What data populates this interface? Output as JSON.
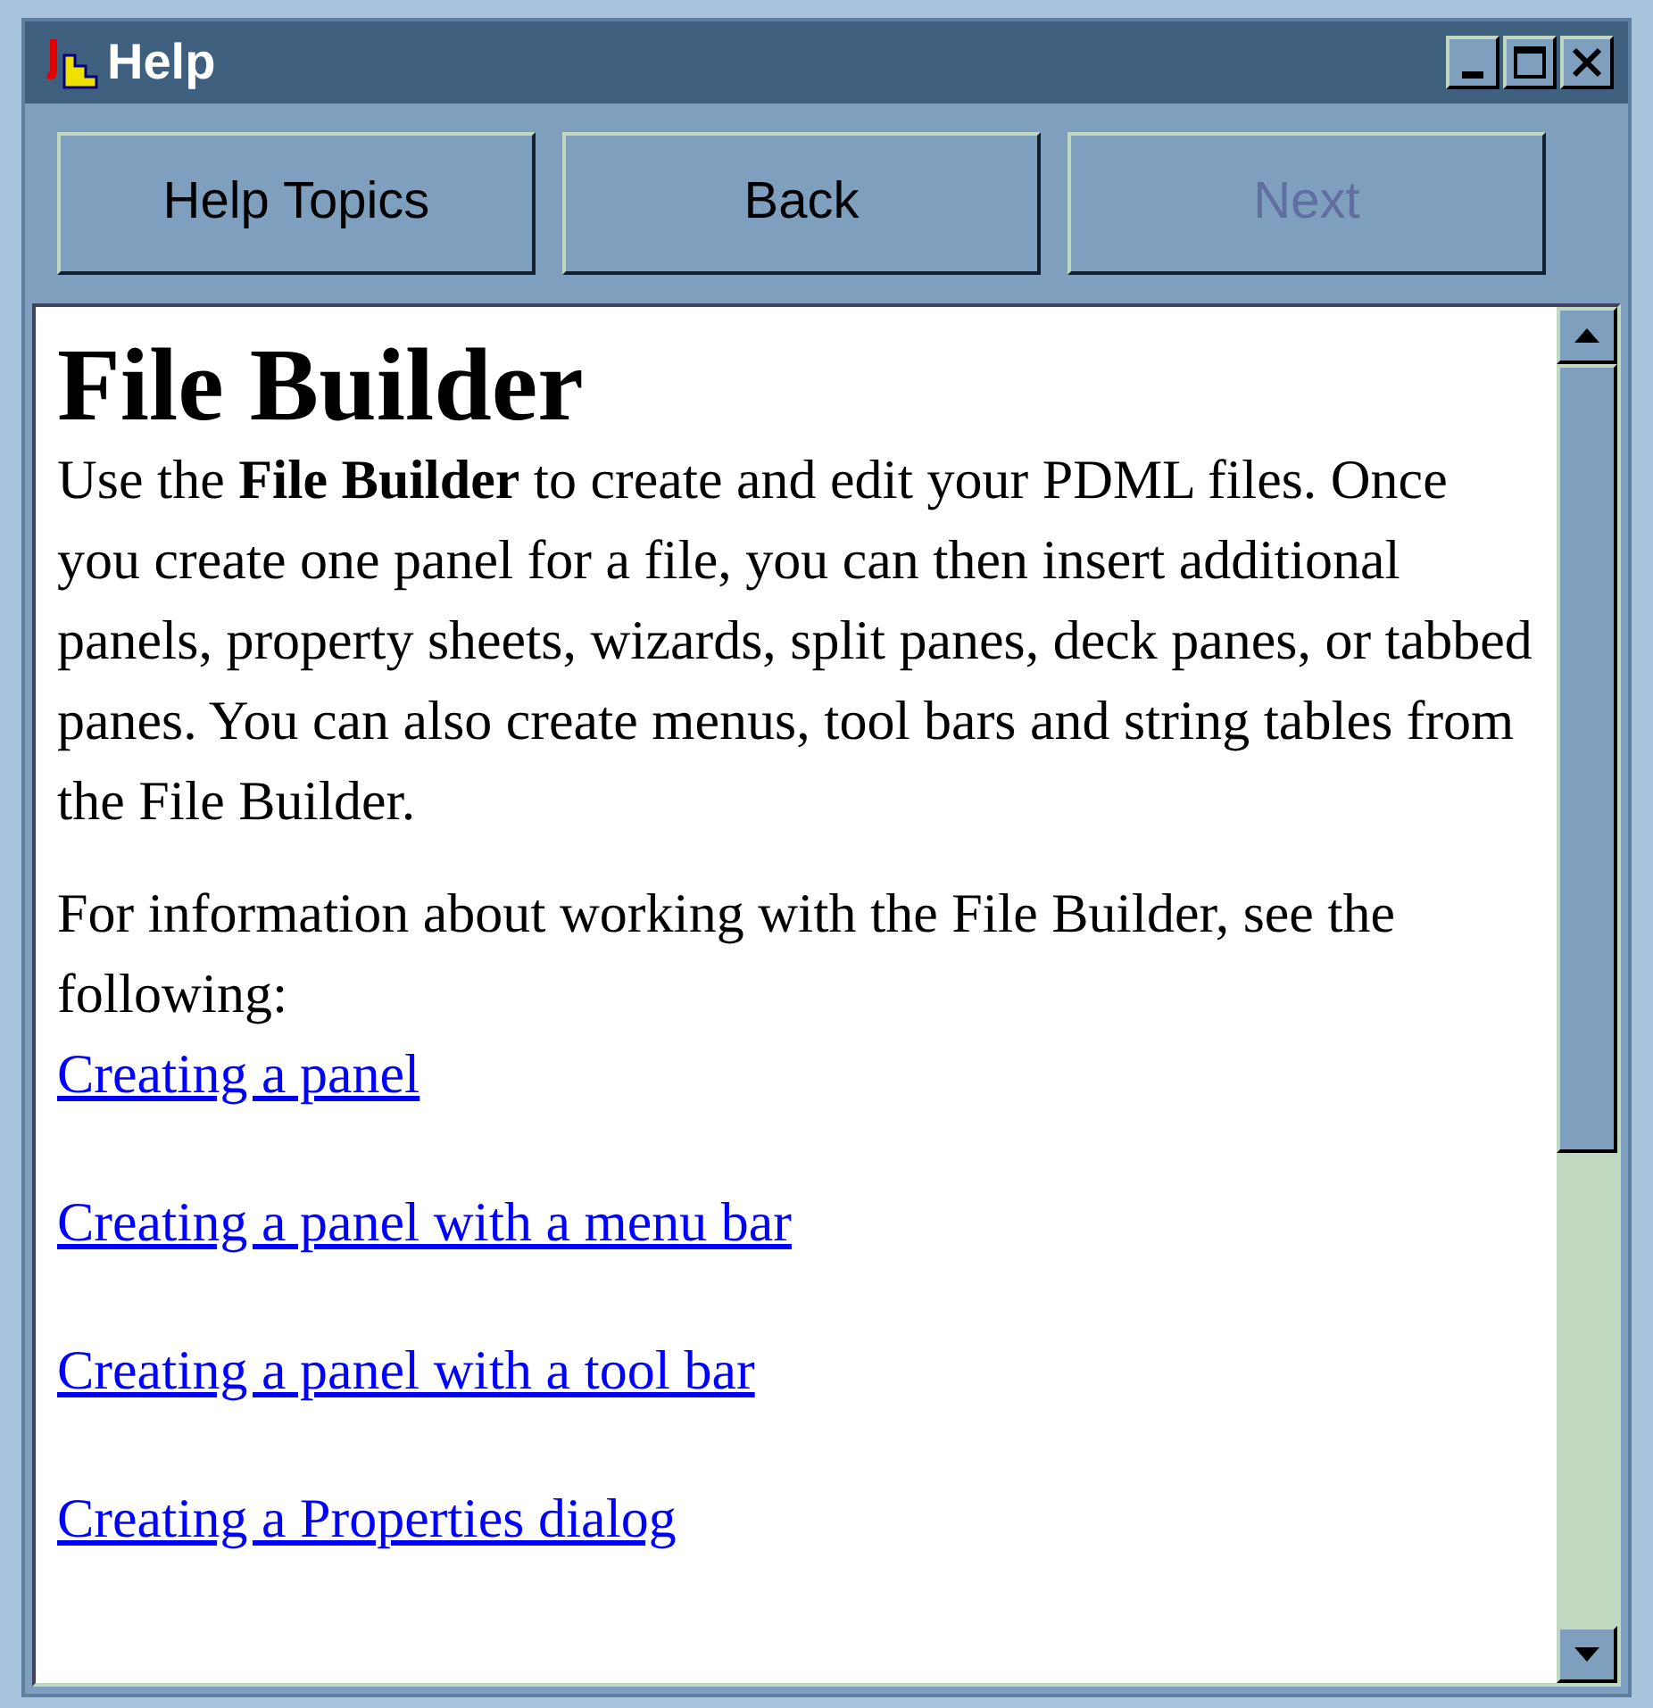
{
  "window": {
    "title": "Help"
  },
  "buttons": [
    {
      "label": "Help Topics",
      "disabled": false
    },
    {
      "label": "Back",
      "disabled": false
    },
    {
      "label": "Next",
      "disabled": true
    }
  ],
  "content": {
    "heading": "File Builder",
    "paragraphs": [
      "Use the **File Builder** to create and edit your PDML files. Once you create one panel for a file, you can then insert additional panels, property sheets, wizards, split panes, deck panes, or tabbed panes. You can also create menus, tool bars and string tables from the File Builder.",
      "For information about working with the File Builder, see the following:"
    ],
    "links": [
      "Creating a panel",
      "Creating a panel with a menu bar",
      "Creating a panel with a tool bar",
      "Creating a Properties dialog"
    ]
  }
}
